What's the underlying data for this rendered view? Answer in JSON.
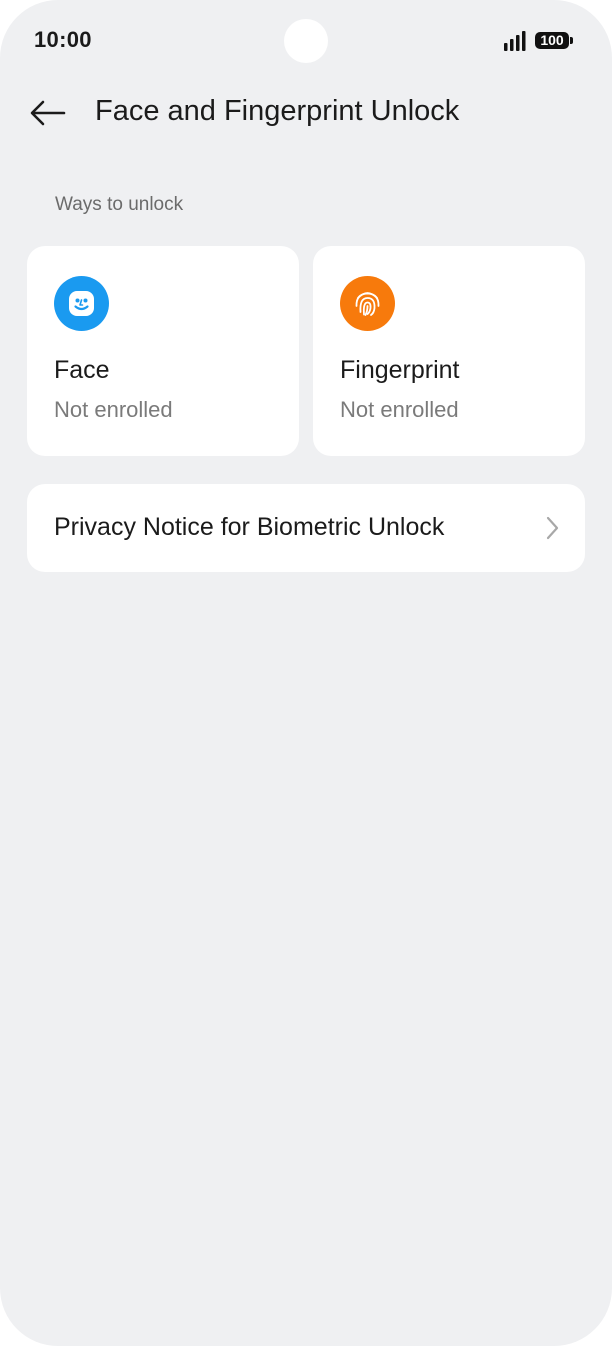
{
  "status_bar": {
    "time": "10:00",
    "battery": "100",
    "icons": [
      "signal-icon",
      "battery-icon"
    ]
  },
  "header": {
    "back_icon": "arrow-left-icon",
    "title": "Face and Fingerprint Unlock"
  },
  "section": {
    "label": "Ways to unlock"
  },
  "unlock_methods": [
    {
      "title": "Face",
      "status": "Not enrolled",
      "icon": "face-icon",
      "color": "#1a9af0"
    },
    {
      "title": "Fingerprint",
      "status": "Not enrolled",
      "icon": "fingerprint-icon",
      "color": "#f77a0c"
    }
  ],
  "privacy": {
    "label": "Privacy Notice for Biometric Unlock",
    "icon": "chevron-right-icon"
  },
  "colors": {
    "background": "#eff0f2",
    "card": "#ffffff",
    "face_accent": "#1a9af0",
    "fingerprint_accent": "#f77a0c"
  }
}
